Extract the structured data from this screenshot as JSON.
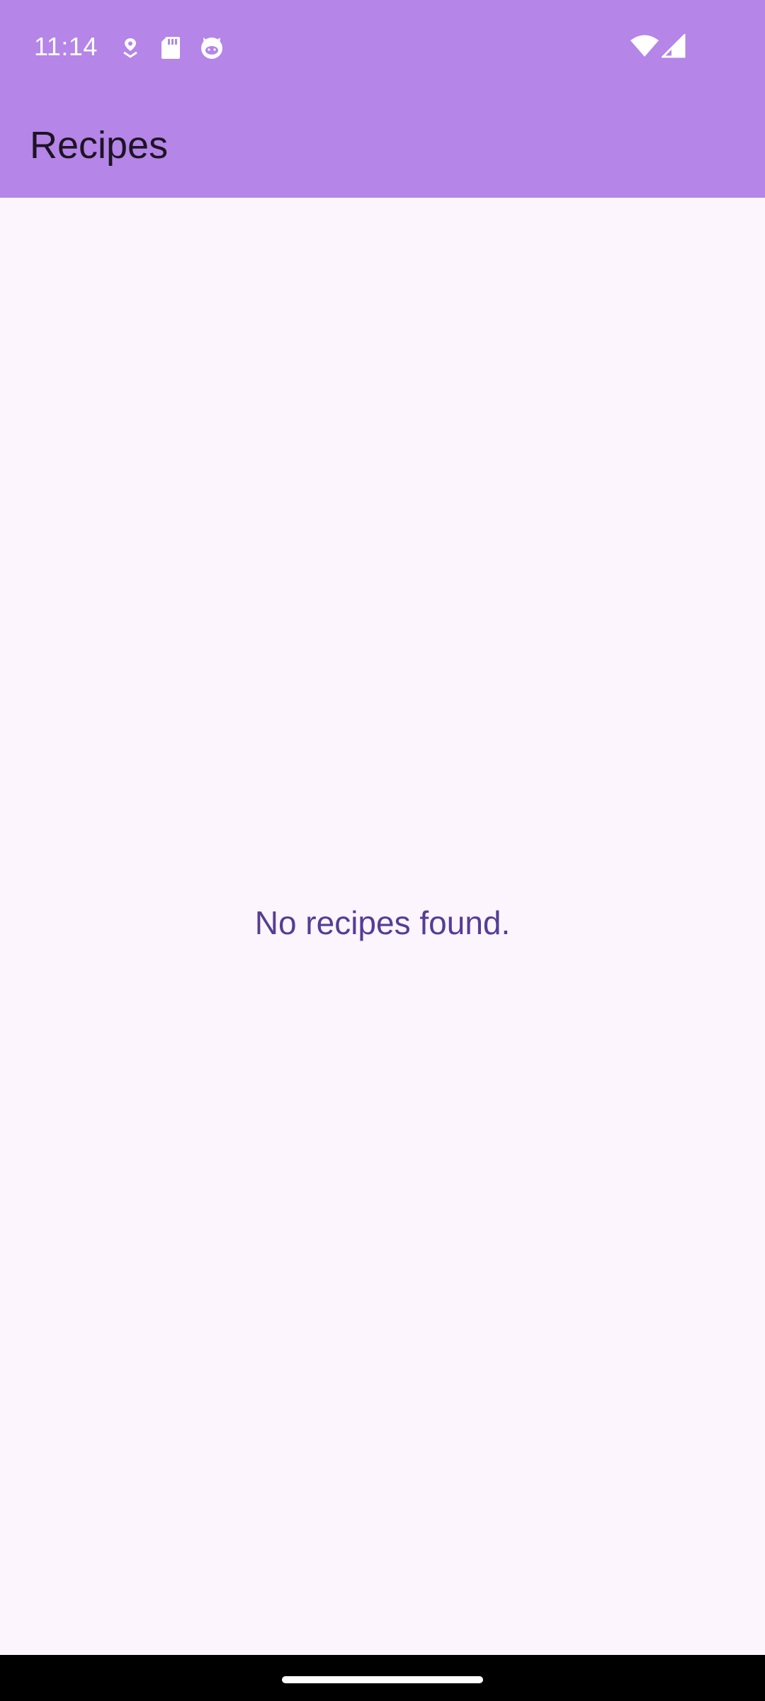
{
  "status_bar": {
    "time": "11:14",
    "background_color": "#B585E8",
    "icons_left": [
      "location-pin-icon",
      "sd-card-icon",
      "cat-face-icon"
    ],
    "icons_right": [
      "wifi-icon",
      "signal-icon"
    ]
  },
  "app_bar": {
    "title": "Recipes",
    "background_color": "#B585E8"
  },
  "content": {
    "empty_message": "No recipes found.",
    "message_color": "#553D96",
    "background_color": "#FCF5FD"
  },
  "nav_bar": {
    "gesture": "home-handle"
  }
}
